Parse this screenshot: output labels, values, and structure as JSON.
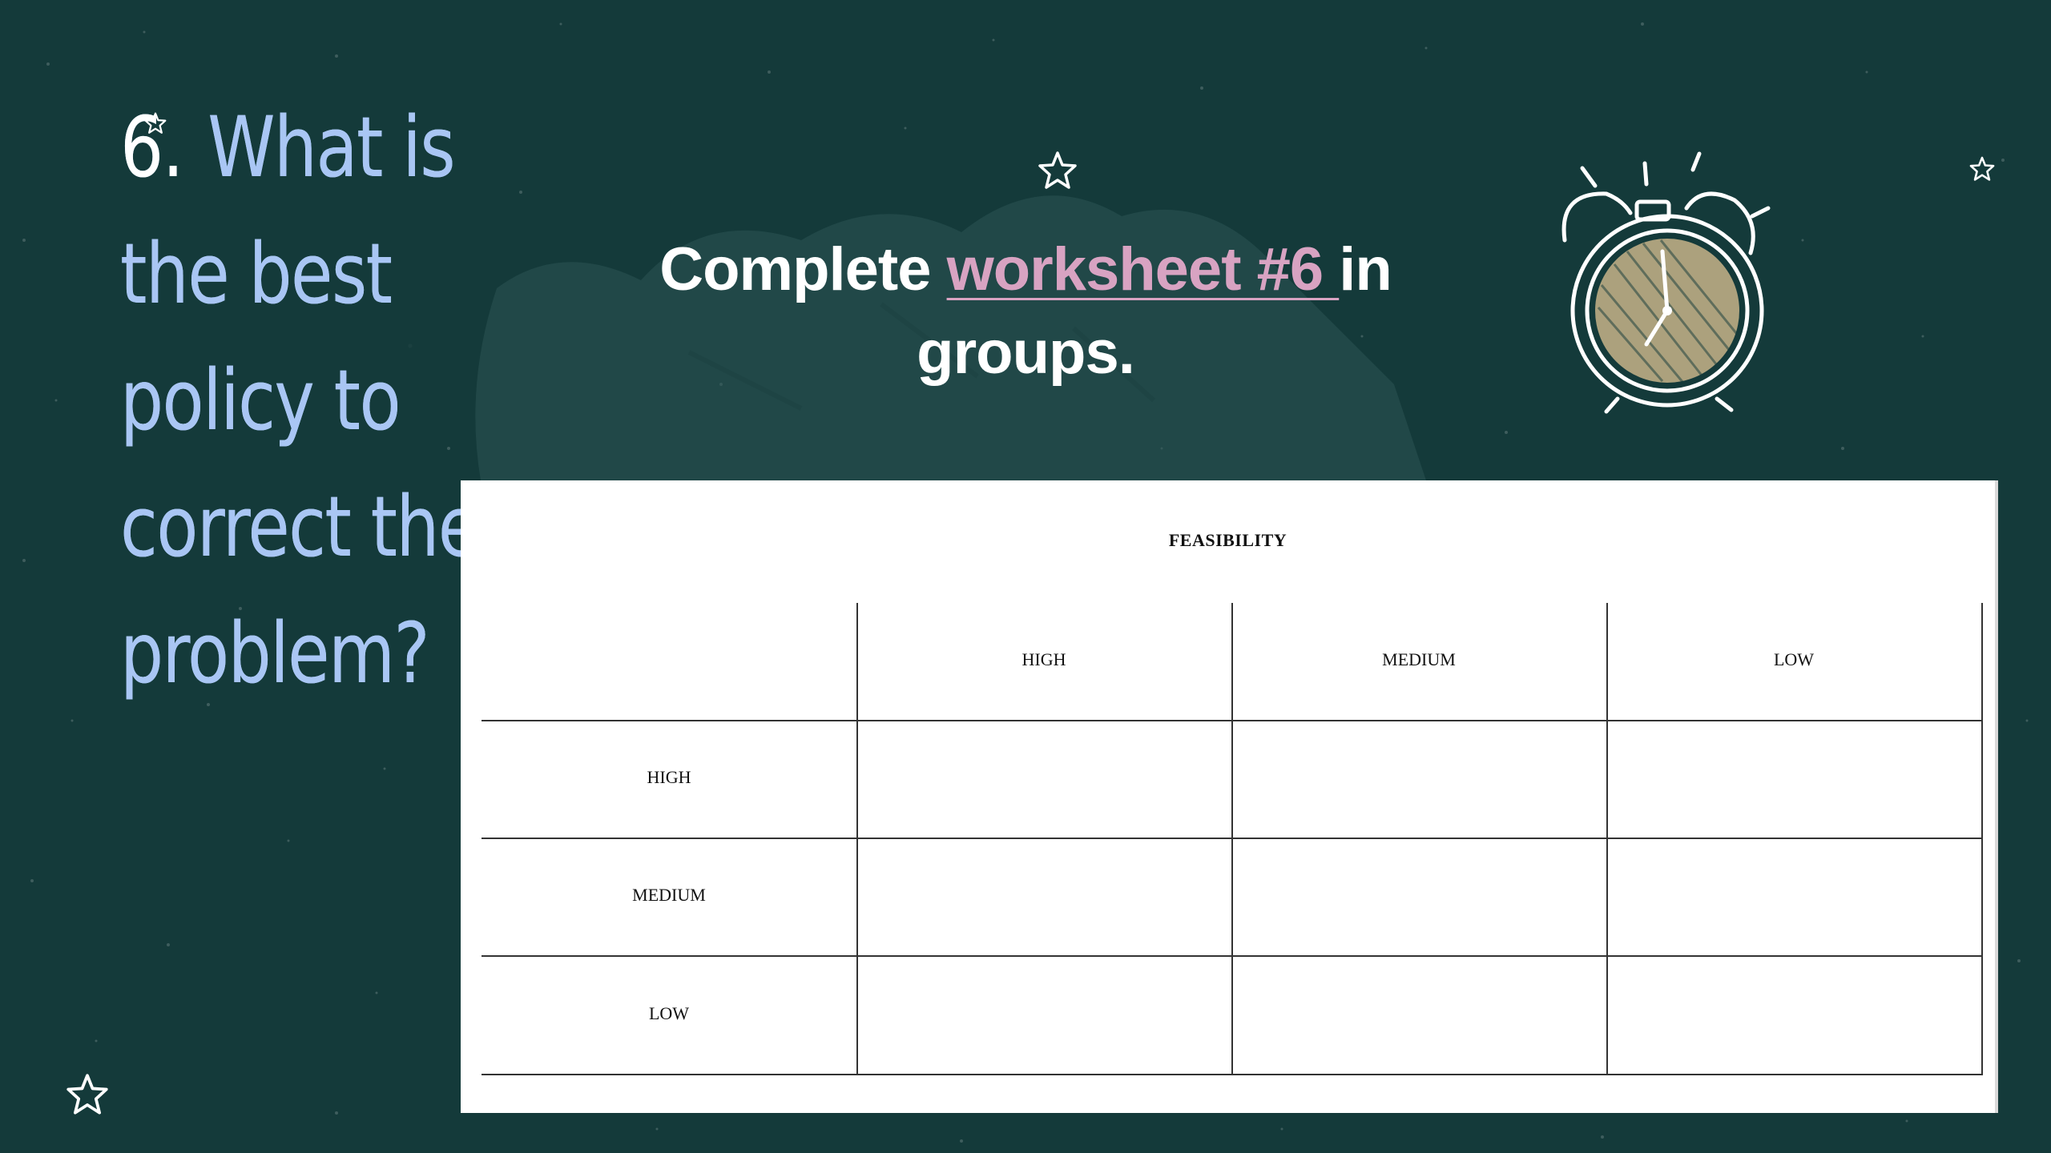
{
  "slide": {
    "question_number": "6.",
    "question_text": "What is the best policy to correct the problem?",
    "instruction": {
      "before": "Complete ",
      "link": "worksheet #6 ",
      "after": " in groups."
    }
  },
  "worksheet": {
    "title": "FEASIBILITY",
    "columns": [
      "HIGH",
      "MEDIUM",
      "LOW"
    ],
    "rows": [
      "HIGH",
      "MEDIUM",
      "LOW"
    ]
  },
  "icons": {
    "decor": [
      "star-icon",
      "alarm-clock-icon"
    ]
  },
  "colors": {
    "background": "#143a3a",
    "question": "#a9c6f4",
    "link": "#d8a3c2",
    "clock_face": "#c7b48a"
  }
}
